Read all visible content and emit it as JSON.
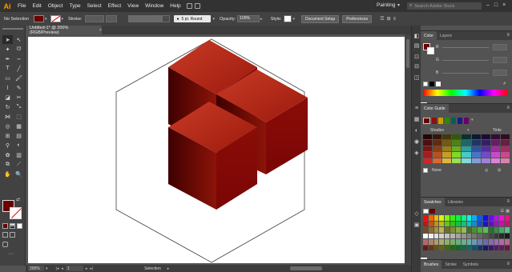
{
  "app": {
    "logo": "Ai",
    "workspace": "Painting"
  },
  "menu": [
    "File",
    "Edit",
    "Object",
    "Type",
    "Select",
    "Effect",
    "View",
    "Window",
    "Help"
  ],
  "search": {
    "placeholder": "Search Adobe Stock"
  },
  "controlbar": {
    "selection": "No Selection",
    "stroke_label": "Stroke:",
    "stroke_preset": "5 pt. Round",
    "opacity_label": "Opacity:",
    "opacity_value": "100%",
    "style_label": "Style:",
    "document_setup": "Document Setup",
    "preferences": "Preferences"
  },
  "document": {
    "tab_title": "Untitled-1* @ 200% (RGB/Preview)",
    "close": "×"
  },
  "status": {
    "zoom": "200%",
    "page": "1",
    "tool": "Selection"
  },
  "panels": {
    "color": {
      "tabs": [
        "Color",
        "Layers"
      ],
      "channels": [
        "R",
        "G",
        "B"
      ]
    },
    "color_guide": {
      "title": "Color Guide",
      "shades": "Shades",
      "tints": "Tints",
      "none": "None"
    },
    "swatches": {
      "tabs": [
        "Swatches",
        "Libraries"
      ]
    },
    "brushes": {
      "tabs": [
        "Brushes",
        "Stroke",
        "Symbols"
      ]
    }
  },
  "colors": {
    "fill": "#6b0000",
    "cube_top": "#b52a1c",
    "cube_left": "#8a1208",
    "cube_right": "#7a0a06"
  },
  "icons": {
    "tools": [
      "selection-arrow",
      "direct-selection",
      "magic-wand",
      "lasso",
      "pen",
      "curvature",
      "type",
      "line-segment",
      "rectangle",
      "paintbrush",
      "shaper",
      "pencil",
      "eraser",
      "rotate",
      "scale",
      "width",
      "free-transform",
      "shape-builder",
      "perspective-grid",
      "mesh",
      "gradient",
      "eyedropper",
      "blend",
      "symbol-sprayer",
      "column-graph",
      "artboard",
      "slice",
      "hand",
      "zoom"
    ]
  }
}
